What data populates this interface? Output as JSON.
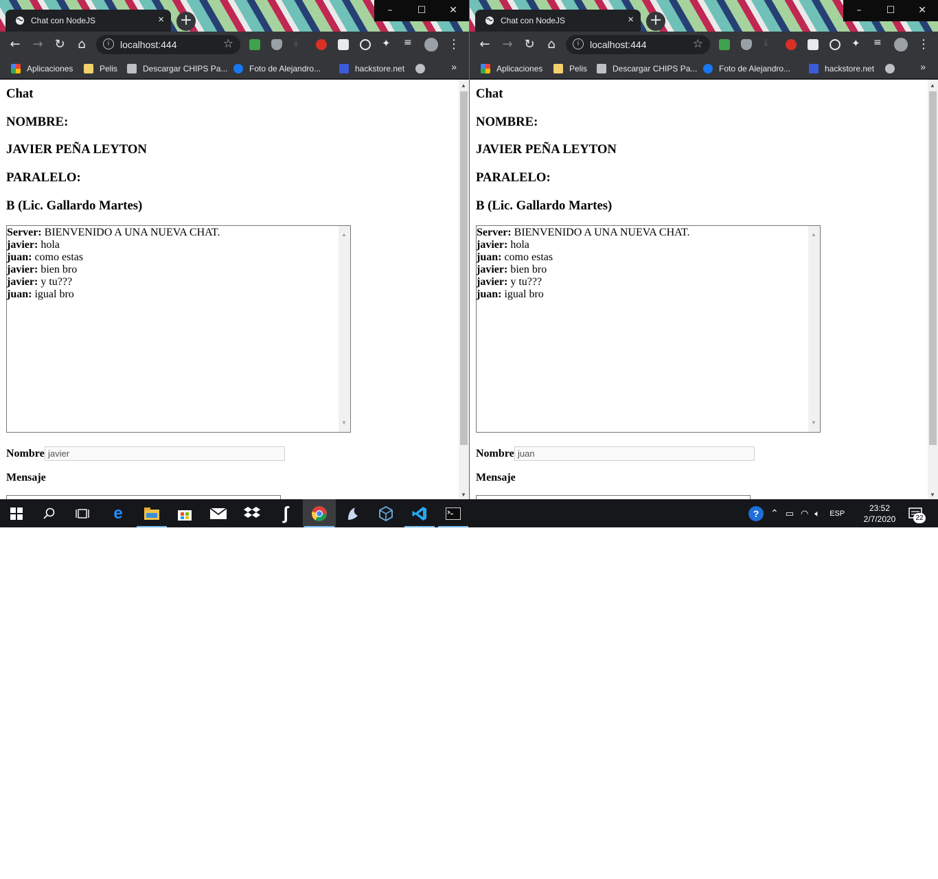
{
  "windows": [
    {
      "tab_title": "Chat con NodeJS",
      "url": "localhost:444",
      "bookmarks": [
        "Aplicaciones",
        "Pelis",
        "Descargar CHIPS Pa...",
        "Foto de Alejandro...",
        "hackstore.net"
      ],
      "page": {
        "heading": "Chat",
        "nombre_label": "NOMBRE:",
        "nombre_value": "JAVIER PEÑA LEYTON",
        "paralelo_label": "PARALELO:",
        "paralelo_value": "B (Lic. Gallardo Martes)",
        "messages": [
          {
            "user": "Server:",
            "text": " BIENVENIDO A UNA NUEVA CHAT."
          },
          {
            "user": "javier:",
            "text": " hola"
          },
          {
            "user": "juan:",
            "text": " como estas"
          },
          {
            "user": "javier:",
            "text": " bien bro"
          },
          {
            "user": "javier:",
            "text": " y tu???"
          },
          {
            "user": "juan:",
            "text": " igual bro"
          }
        ],
        "form_nombre_label": "Nombre",
        "form_nombre_value": "javier",
        "form_mensaje_label": "Mensaje"
      }
    },
    {
      "tab_title": "Chat con NodeJS",
      "url": "localhost:444",
      "bookmarks": [
        "Aplicaciones",
        "Pelis",
        "Descargar CHIPS Pa...",
        "Foto de Alejandro...",
        "hackstore.net"
      ],
      "page": {
        "heading": "Chat",
        "nombre_label": "NOMBRE:",
        "nombre_value": "JAVIER PEÑA LEYTON",
        "paralelo_label": "PARALELO:",
        "paralelo_value": "B (Lic. Gallardo Martes)",
        "messages": [
          {
            "user": "Server:",
            "text": " BIENVENIDO A UNA NUEVA CHAT."
          },
          {
            "user": "javier:",
            "text": " hola"
          },
          {
            "user": "juan:",
            "text": " como estas"
          },
          {
            "user": "javier:",
            "text": " bien bro"
          },
          {
            "user": "javier:",
            "text": " y tu???"
          },
          {
            "user": "juan:",
            "text": " igual bro"
          }
        ],
        "form_nombre_label": "Nombre",
        "form_nombre_value": "juan",
        "form_mensaje_label": "Mensaje"
      }
    }
  ],
  "taskbar": {
    "language": "ESP",
    "time": "23:52",
    "date": "2/7/2020",
    "notification_count": "22",
    "icons": [
      "windows-start-icon",
      "search-icon",
      "task-view-icon",
      "edge-icon",
      "file-explorer-icon",
      "store-icon",
      "mail-icon",
      "dropbox-icon",
      "app-icon",
      "chrome-icon",
      "app-icon",
      "virtualbox-icon",
      "vscode-icon",
      "terminal-icon"
    ]
  },
  "colors": {
    "chrome_dark": "#202124",
    "toolbar": "#35363a",
    "taskbar": "#16171b",
    "accent": "#76b9ed"
  }
}
